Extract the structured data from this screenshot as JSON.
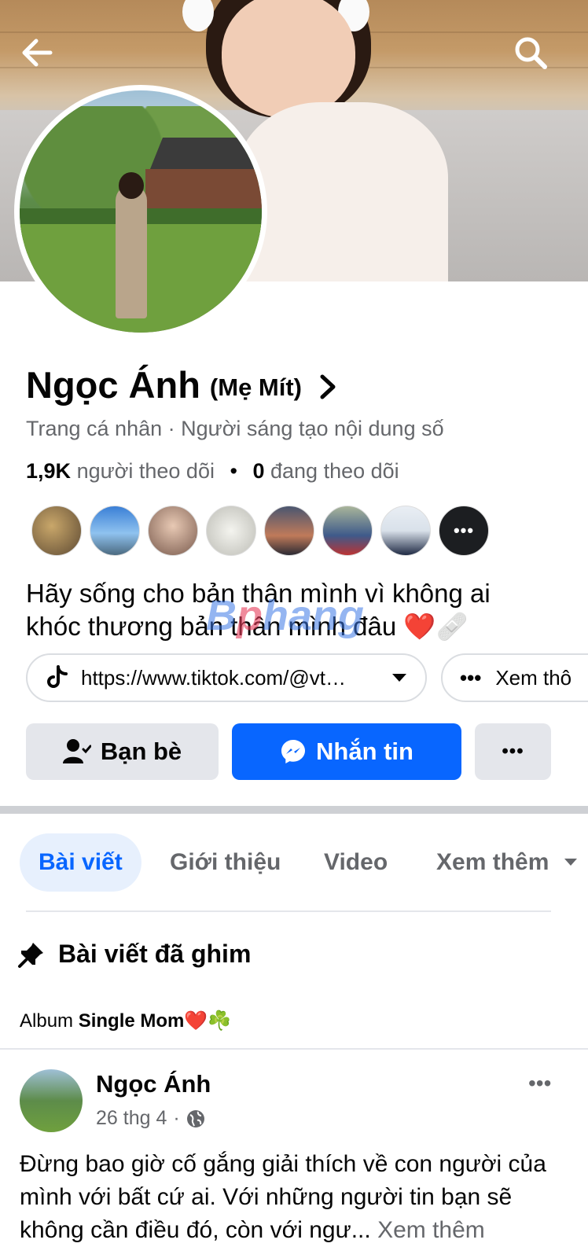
{
  "header": {
    "back_icon": "arrow-left-icon",
    "search_icon": "search-icon"
  },
  "profile": {
    "name": "Ngọc Ánh",
    "nickname": "(Mẹ Mít)",
    "subtitle": "Trang cá nhân · Người sáng tạo nội dung số",
    "followers_count": "1,9K",
    "followers_label": "người theo dõi",
    "separator": "•",
    "following_count": "0",
    "following_label": "đang theo dõi",
    "friends_more": "•••",
    "bio": "Hãy sống cho bản thân mình vì không ai khóc thương bản thân mình đâu ❤️🩹",
    "watermark": "Bphang"
  },
  "links": {
    "tiktok_url": "https://www.tiktok.com/@vt…",
    "more_dots": "•••",
    "more_label": "Xem thô"
  },
  "actions": {
    "friends_label": "Bạn bè",
    "message_label": "Nhắn tin",
    "more_dots": "•••"
  },
  "tabs": [
    {
      "label": "Bài viết"
    },
    {
      "label": "Giới thiệu"
    },
    {
      "label": "Video"
    },
    {
      "label": "Xem thêm"
    }
  ],
  "pinned": {
    "title": "Bài viết đã ghim",
    "album_prefix": "Album",
    "album_name": "Single Mom❤️☘️"
  },
  "post": {
    "author": "Ngọc Ánh",
    "date": "26 thg 4",
    "meta_sep": "·",
    "dots": "•••",
    "text": "Đừng bao giờ cố gắng giải thích về con người của mình với bất cứ ai. Với những người tin bạn sẽ không cần điều đó, còn với ngư...",
    "see_more": "Xem thêm"
  },
  "colors": {
    "accent": "#0866ff",
    "secondary_text": "#65676b",
    "button_gray": "#e4e6eb"
  }
}
